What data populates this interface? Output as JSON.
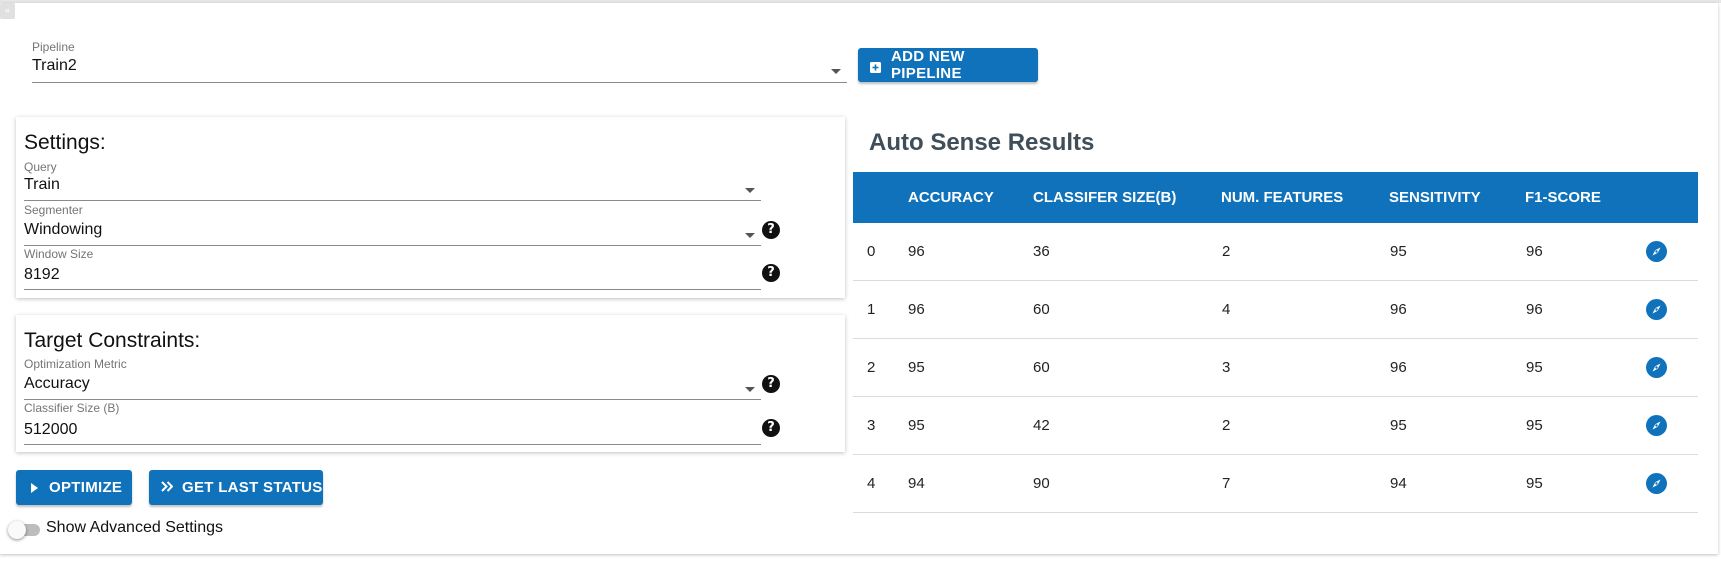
{
  "pipeline": {
    "label": "Pipeline",
    "value": "Train2",
    "add_button": "ADD NEW PIPELINE"
  },
  "settings": {
    "title": "Settings:",
    "query": {
      "label": "Query",
      "value": "Train"
    },
    "segmenter": {
      "label": "Segmenter",
      "value": "Windowing"
    },
    "window_size": {
      "label": "Window Size",
      "value": "8192"
    }
  },
  "constraints": {
    "title": "Target Constraints:",
    "metric": {
      "label": "Optimization Metric",
      "value": "Accuracy"
    },
    "classifier_size": {
      "label": "Classifier Size (B)",
      "value": "512000"
    }
  },
  "actions": {
    "optimize": "OPTIMIZE",
    "last_status": "GET LAST STATUS",
    "advanced_settings": "Show Advanced Settings"
  },
  "results": {
    "title": "Auto Sense Results",
    "columns": [
      "ACCURACY",
      "CLASSIFER SIZE(B)",
      "NUM. FEATURES",
      "SENSITIVITY",
      "F1-SCORE"
    ],
    "rows": [
      {
        "index": "0",
        "accuracy": "96",
        "size": "36",
        "features": "2",
        "sensitivity": "95",
        "f1": "96"
      },
      {
        "index": "1",
        "accuracy": "96",
        "size": "60",
        "features": "4",
        "sensitivity": "96",
        "f1": "96"
      },
      {
        "index": "2",
        "accuracy": "95",
        "size": "60",
        "features": "3",
        "sensitivity": "96",
        "f1": "95"
      },
      {
        "index": "3",
        "accuracy": "95",
        "size": "42",
        "features": "2",
        "sensitivity": "95",
        "f1": "95"
      },
      {
        "index": "4",
        "accuracy": "94",
        "size": "90",
        "features": "7",
        "sensitivity": "94",
        "f1": "95"
      }
    ]
  },
  "icons": {
    "help": "?",
    "collapse": "«",
    "row_action": "compass-icon",
    "add": "plus-square-icon",
    "optimize": "play-icon",
    "last_status": "double-chevron-right-icon"
  },
  "colors": {
    "accent": "#0f72bb",
    "heading": "#3f4e59"
  }
}
